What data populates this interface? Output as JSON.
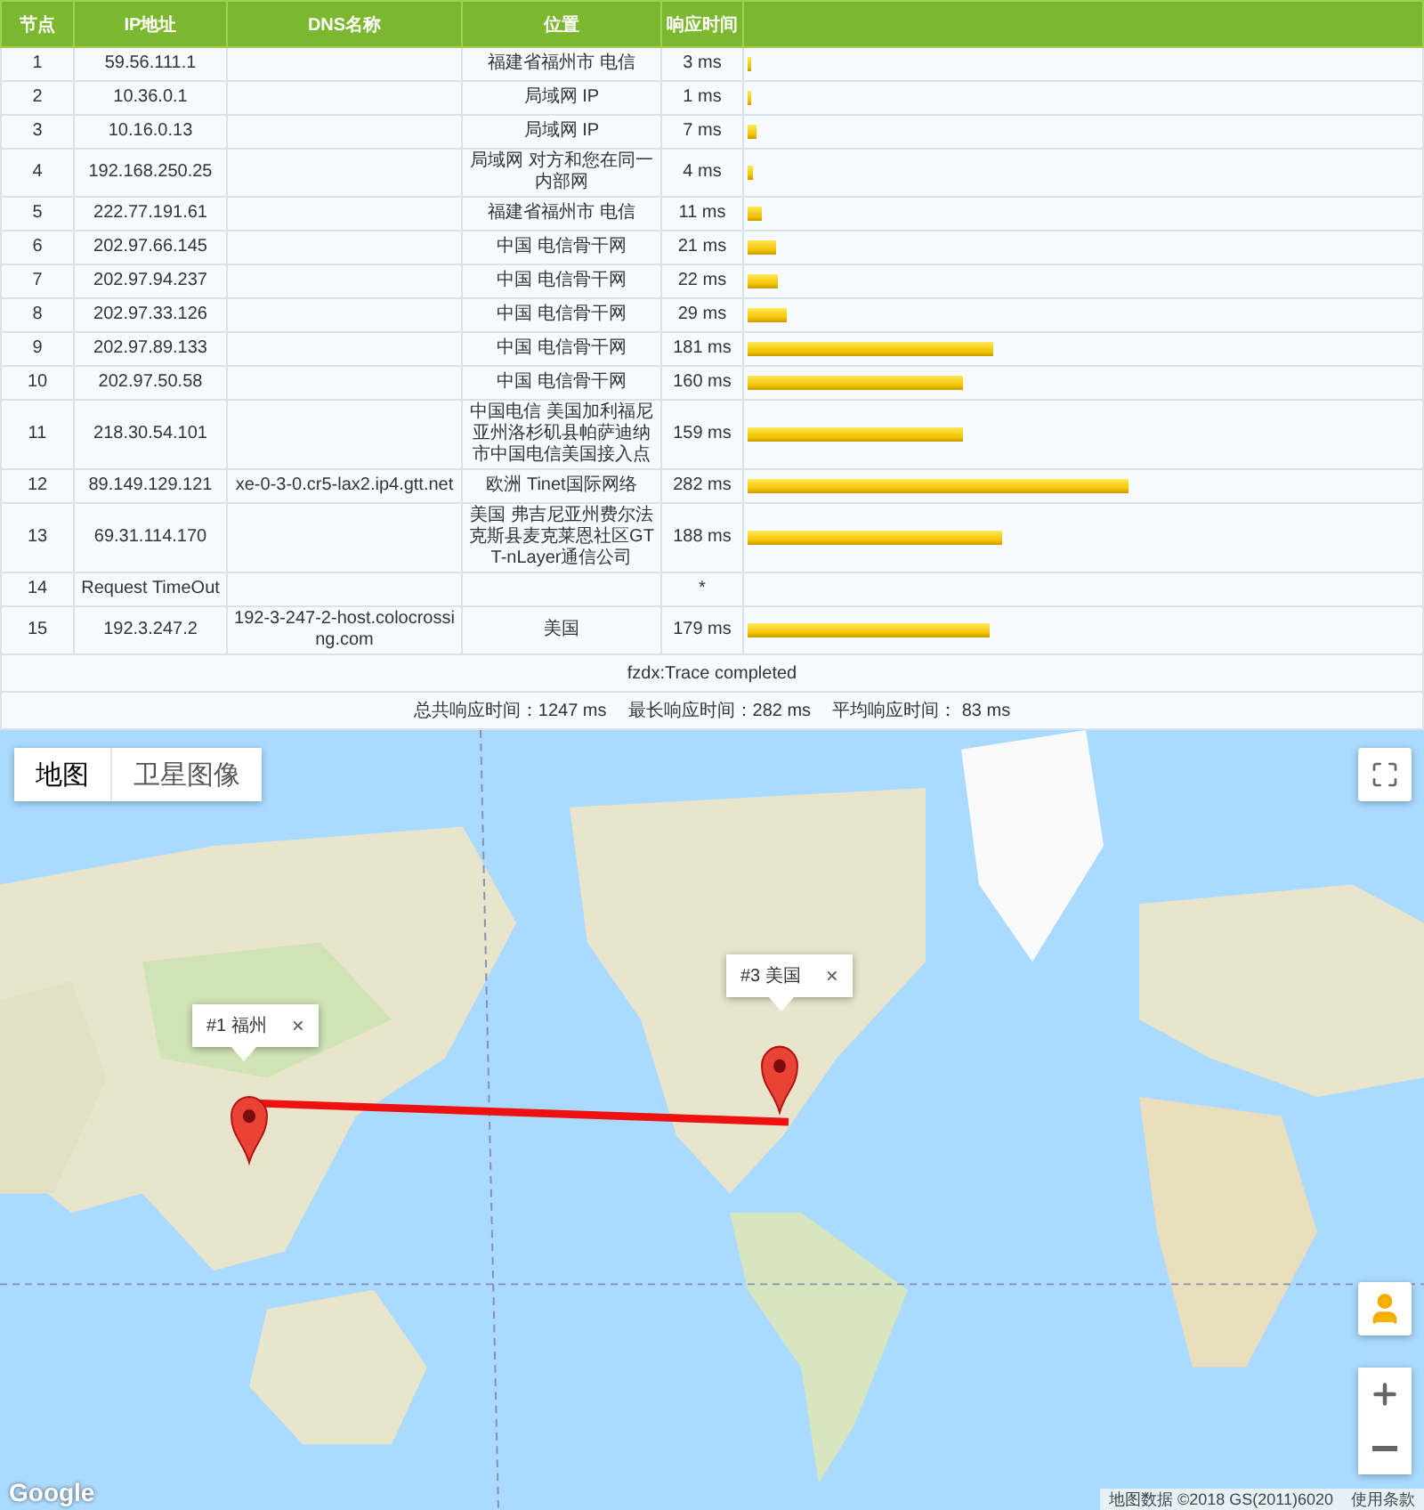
{
  "table": {
    "columns": [
      "节点",
      "IP地址",
      "DNS名称",
      "位置",
      "响应时间"
    ],
    "rows": [
      {
        "node": "1",
        "ip": "59.56.111.1",
        "dns": "",
        "location": "福建省福州市 电信",
        "time": "3 ms",
        "level": 0.006
      },
      {
        "node": "2",
        "ip": "10.36.0.1",
        "dns": "",
        "location": "局域网 IP",
        "time": "1 ms",
        "level": 0.002
      },
      {
        "node": "3",
        "ip": "10.16.0.13",
        "dns": "",
        "location": "局域网 IP",
        "time": "7 ms",
        "level": 0.014
      },
      {
        "node": "4",
        "ip": "192.168.250.25",
        "dns": "",
        "location": "局域网 对方和您在同一内部网",
        "time": "4 ms",
        "level": 0.008
      },
      {
        "node": "5",
        "ip": "222.77.191.61",
        "dns": "",
        "location": "福建省福州市 电信",
        "time": "11 ms",
        "level": 0.022
      },
      {
        "node": "6",
        "ip": "202.97.66.145",
        "dns": "",
        "location": "中国 电信骨干网",
        "time": "21 ms",
        "level": 0.042
      },
      {
        "node": "7",
        "ip": "202.97.94.237",
        "dns": "",
        "location": "中国 电信骨干网",
        "time": "22 ms",
        "level": 0.044
      },
      {
        "node": "8",
        "ip": "202.97.33.126",
        "dns": "",
        "location": "中国 电信骨干网",
        "time": "29 ms",
        "level": 0.058
      },
      {
        "node": "9",
        "ip": "202.97.89.133",
        "dns": "",
        "location": "中国 电信骨干网",
        "time": "181 ms",
        "level": 0.365
      },
      {
        "node": "10",
        "ip": "202.97.50.58",
        "dns": "",
        "location": "中国 电信骨干网",
        "time": "160 ms",
        "level": 0.322
      },
      {
        "node": "11",
        "ip": "218.30.54.101",
        "dns": "",
        "location": "中国电信 美国加利福尼亚州洛杉矶县帕萨迪纳市中国电信美国接入点",
        "time": "159 ms",
        "level": 0.32
      },
      {
        "node": "12",
        "ip": "89.149.129.121",
        "dns": "xe-0-3-0.cr5-lax2.ip4.gtt.net",
        "location": "欧洲 Tinet国际网络",
        "time": "282 ms",
        "level": 0.568
      },
      {
        "node": "13",
        "ip": "69.31.114.170",
        "dns": "",
        "location": "美国 弗吉尼亚州费尔法克斯县麦克莱恩社区GTT-nLayer通信公司",
        "time": "188 ms",
        "level": 0.379
      },
      {
        "node": "14",
        "ip": "Request TimeOut",
        "dns": "",
        "location": "",
        "time": "*"
      },
      {
        "node": "15",
        "ip": "192.3.247.2",
        "dns": "192-3-247-2-host.colocrossing.com",
        "location": "美国",
        "time": "179 ms",
        "level": 0.36
      }
    ],
    "status": "fzdx:Trace completed",
    "summary": [
      "总共响应时间：1247 ms",
      "最长响应时间：282 ms",
      "平均响应时间： 83 ms"
    ]
  },
  "map": {
    "map_types": [
      {
        "label": "地图",
        "selected": true
      },
      {
        "label": "卫星图像",
        "selected": false
      }
    ],
    "markers": [
      {
        "label": "#1 福州",
        "close": "×"
      },
      {
        "label": "#3 美国",
        "close": "×"
      }
    ],
    "logo": "Google",
    "attribution": [
      "地图数据 ©2018 GS(2011)6020",
      "使用条款"
    ]
  }
}
